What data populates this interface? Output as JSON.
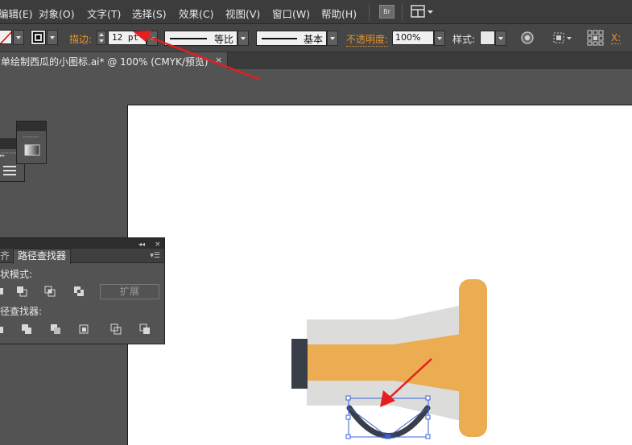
{
  "menu": {
    "items": [
      "编辑(E)",
      "对象(O)",
      "文字(T)",
      "选择(S)",
      "效果(C)",
      "视图(V)",
      "窗口(W)",
      "帮助(H)"
    ],
    "bridge_label": "Br",
    "workspace_icon": "workspace-switcher-icon"
  },
  "control_bar": {
    "stroke_label": "描边:",
    "stroke_value": "12 pt",
    "profile_label": "等比",
    "brush_label": "基本",
    "opacity_label": "不透明度:",
    "opacity_value": "100%",
    "style_label": "样式:",
    "x_label": "X:"
  },
  "document": {
    "tab_title": "单绘制西瓜的小图标.ai* @ 100% (CMYK/预览)",
    "close_glyph": "×"
  },
  "pathfinder": {
    "prev_tab": "齐",
    "tab": "路径查找器",
    "shape_modes_label": "状模式:",
    "expand_label": "扩展",
    "pathfinders_label": "径查找器:"
  },
  "colors": {
    "accent_orange": "#e8922e",
    "annotation_red": "#e61e1e",
    "art_orange": "#ebac52",
    "art_gray": "#dcdcdb",
    "art_dark": "#3a3e48",
    "selection_blue": "#3a62d8"
  }
}
